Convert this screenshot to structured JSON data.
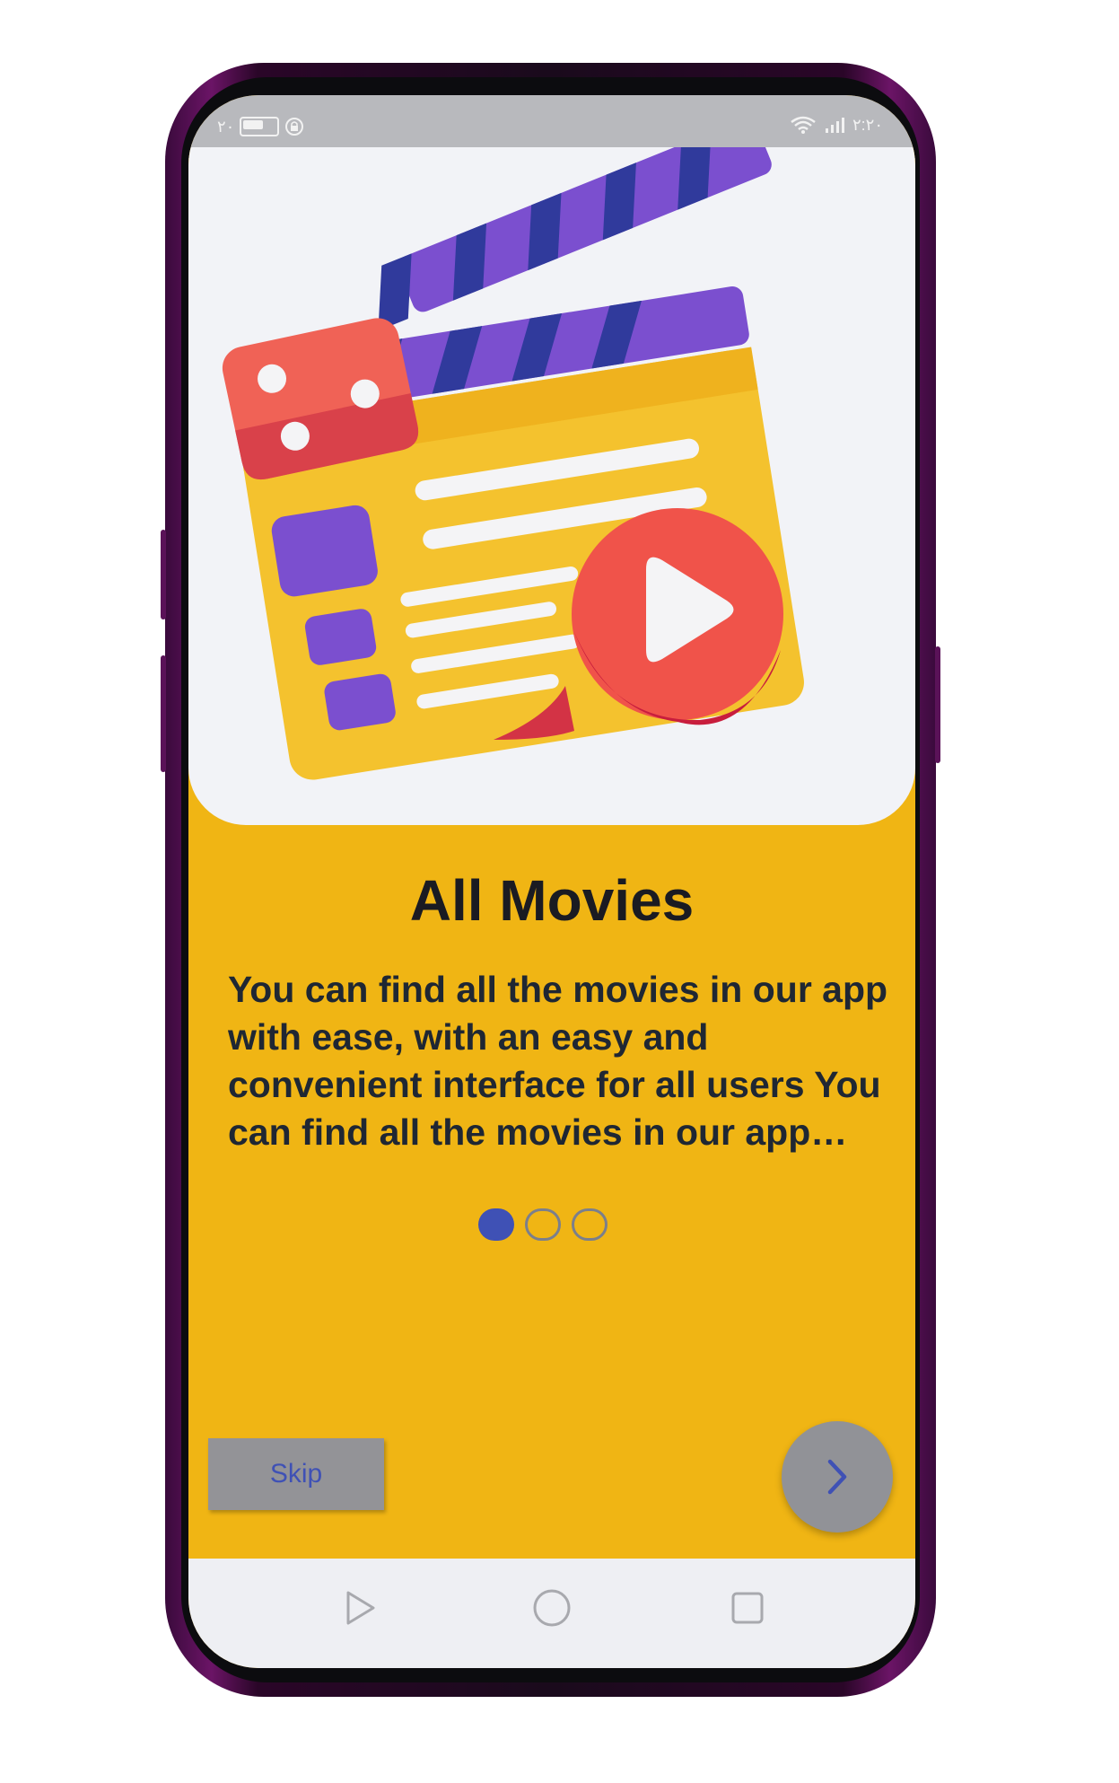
{
  "status_bar": {
    "left_text": "٢٠",
    "time": "٢:٢٠"
  },
  "onboarding": {
    "title": "All Movies",
    "description": "You can find all the movies in our app with ease, with an easy and convenient interface for all users You can find all the movies in our app with ease, with an easy and convenient interface for all users",
    "page_indicator": {
      "current": 1,
      "total": 3
    },
    "skip_label": "Skip",
    "next_icon": "chevron-right-icon"
  },
  "nav_bar": {
    "back_icon": "triangle-back-icon",
    "home_icon": "circle-home-icon",
    "recents_icon": "square-recents-icon"
  },
  "colors": {
    "background": "#f0b514",
    "hero_background": "#f2f3f7",
    "accent": "#3f51b5",
    "title": "#1a1b22",
    "button_gray": "#939397"
  }
}
